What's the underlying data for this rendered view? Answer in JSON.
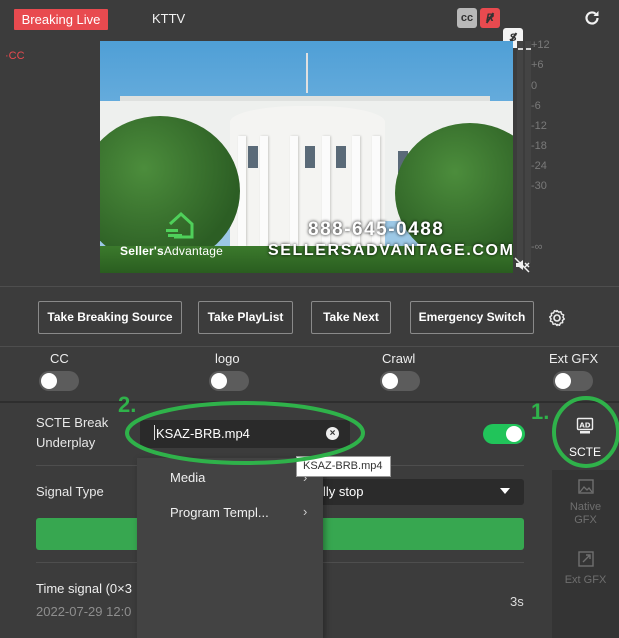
{
  "header": {
    "live_badge": "Breaking Live",
    "station": "KTTV",
    "cc_indicator": "·CC",
    "quick_buttons": [
      {
        "label": "cc",
        "icon": "cc-icon",
        "color": "#b8b8b8"
      },
      {
        "label": "R",
        "icon": "r-disabled-icon",
        "color": "#e84a4f"
      },
      {
        "label": "S",
        "icon": "s-disabled-icon",
        "color": "#f3f3f3"
      }
    ],
    "refresh_icon": "refresh-icon"
  },
  "preview": {
    "phone": "888-645-0488",
    "website": "SELLERSADVANTAGE.COM",
    "logo_bold": "Seller's",
    "logo_light": "Advantage"
  },
  "audio_meter": {
    "labels": [
      "+12",
      "+6",
      "0",
      "-6",
      "-12",
      "-18",
      "-24",
      "-30",
      "-∞"
    ],
    "mute_icon": "speaker-muted-icon"
  },
  "actions": {
    "take_breaking_source": "Take Breaking Source",
    "take_playlist": "Take PlayList",
    "take_next": "Take Next",
    "emergency_switch": "Emergency Switch",
    "settings_icon": "gear-icon"
  },
  "toggles": [
    {
      "label": "CC",
      "on": false
    },
    {
      "label": "logo",
      "on": false
    },
    {
      "label": "Crawl",
      "on": false
    },
    {
      "label": "Ext GFX",
      "on": false
    }
  ],
  "scte": {
    "break_label_1": "SCTE Break",
    "break_label_2": "Underplay",
    "file_value": "KSAZ-BRB.mp4",
    "underplay_enabled": true,
    "signal_type_label": "Signal Type",
    "signal_type_value": "lly stop",
    "time_signal_title": "Time signal (0×3",
    "time_signal_date": "2022-07-29 12:0",
    "time_signal_duration": "3s"
  },
  "context_menu": {
    "items": [
      {
        "label": "Media",
        "has_submenu": true
      },
      {
        "label": "Program Templ...",
        "has_submenu": true
      }
    ]
  },
  "tooltip": "KSAZ-BRB.mp4",
  "side_nav": [
    {
      "label": "SCTE",
      "icon": "ad-monitor-icon",
      "active": true
    },
    {
      "label": "Native GFX",
      "icon": "image-icon",
      "active": false
    },
    {
      "label": "Ext GFX",
      "icon": "external-image-icon",
      "active": false
    }
  ],
  "annotations": {
    "step1": "1.",
    "step2": "2."
  },
  "colors": {
    "accent_red": "#e84a4f",
    "accent_green": "#21c45a",
    "bar_green": "#37a750",
    "annotation_green": "#2fb24a"
  }
}
